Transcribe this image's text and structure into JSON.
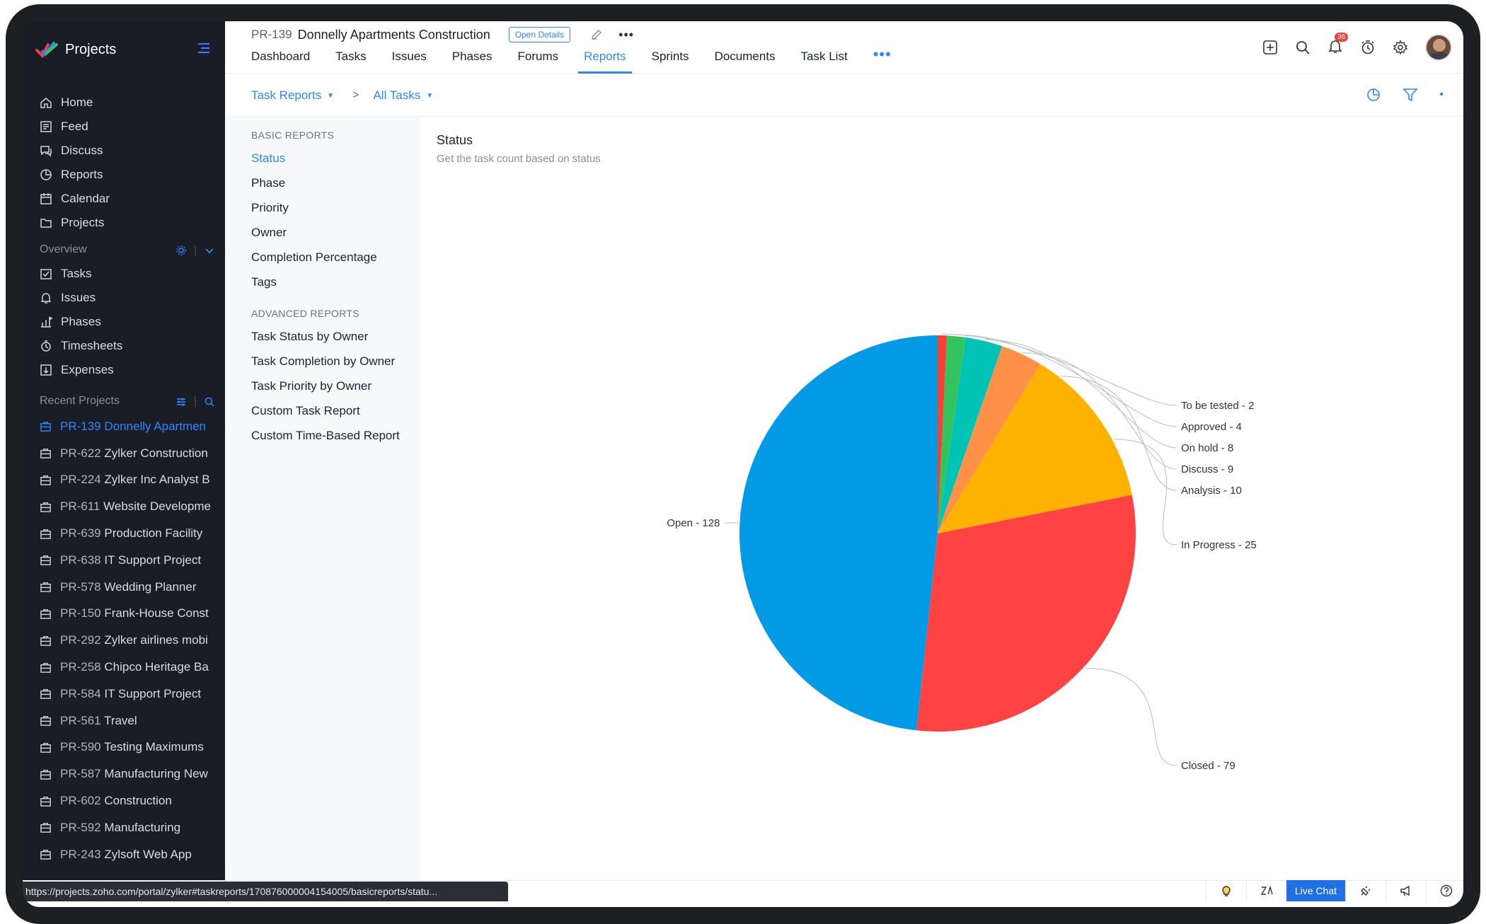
{
  "app": {
    "title": "Projects"
  },
  "sidebar": {
    "main_items": [
      {
        "label": "Home",
        "icon": "home-icon"
      },
      {
        "label": "Feed",
        "icon": "feed-icon"
      },
      {
        "label": "Discuss",
        "icon": "discuss-icon"
      },
      {
        "label": "Reports",
        "icon": "reports-icon"
      },
      {
        "label": "Calendar",
        "icon": "calendar-icon"
      },
      {
        "label": "Projects",
        "icon": "projects-icon"
      }
    ],
    "overview": {
      "title": "Overview",
      "items": [
        {
          "label": "Tasks",
          "icon": "tasks-icon"
        },
        {
          "label": "Issues",
          "icon": "issues-icon"
        },
        {
          "label": "Phases",
          "icon": "phases-icon"
        },
        {
          "label": "Timesheets",
          "icon": "timesheets-icon"
        },
        {
          "label": "Expenses",
          "icon": "expenses-icon"
        }
      ]
    },
    "recent": {
      "title": "Recent Projects",
      "items": [
        {
          "code": "PR-139",
          "name": "Donnelly Apartmen",
          "active": true
        },
        {
          "code": "PR-622",
          "name": "Zylker Construction"
        },
        {
          "code": "PR-224",
          "name": "Zylker Inc Analyst B"
        },
        {
          "code": "PR-611",
          "name": "Website Developme"
        },
        {
          "code": "PR-639",
          "name": "Production Facility"
        },
        {
          "code": "PR-638",
          "name": "IT Support Project"
        },
        {
          "code": "PR-578",
          "name": "Wedding Planner"
        },
        {
          "code": "PR-150",
          "name": "Frank-House Const"
        },
        {
          "code": "PR-292",
          "name": "Zylker airlines mobi"
        },
        {
          "code": "PR-258",
          "name": "Chipco Heritage Ba"
        },
        {
          "code": "PR-584",
          "name": "IT Support Project"
        },
        {
          "code": "PR-561",
          "name": "Travel"
        },
        {
          "code": "PR-590",
          "name": "Testing Maximums"
        },
        {
          "code": "PR-587",
          "name": "Manufacturing New"
        },
        {
          "code": "PR-602",
          "name": "Construction"
        },
        {
          "code": "PR-592",
          "name": "Manufacturing"
        },
        {
          "code": "PR-243",
          "name": "Zylsoft Web App"
        }
      ]
    }
  },
  "header": {
    "project_code": "PR-139",
    "project_name": "Donnelly Apartments Construction",
    "open_details": "Open Details",
    "tabs": [
      "Dashboard",
      "Tasks",
      "Issues",
      "Phases",
      "Forums",
      "Reports",
      "Sprints",
      "Documents",
      "Task List"
    ],
    "active_tab": "Reports",
    "more": "•••",
    "notification_count": "36"
  },
  "subheader": {
    "crumb1": "Task Reports",
    "crumb_sep": ">",
    "crumb2": "All Tasks"
  },
  "reports_menu": {
    "basic_title": "BASIC REPORTS",
    "basic": [
      "Status",
      "Phase",
      "Priority",
      "Owner",
      "Completion Percentage",
      "Tags"
    ],
    "advanced_title": "ADVANCED REPORTS",
    "advanced": [
      "Task Status by Owner",
      "Task Completion by Owner",
      "Task Priority by Owner",
      "Custom Task Report",
      "Custom Time-Based Report"
    ]
  },
  "report": {
    "title": "Status",
    "subtitle": "Get the task count based on status"
  },
  "chart_data": {
    "type": "pie",
    "slices": [
      {
        "label": "Open",
        "value": 128,
        "color": "#039be5"
      },
      {
        "label": "To be tested",
        "value": 2,
        "color": "#f44336"
      },
      {
        "label": "Approved",
        "value": 4,
        "color": "#33c45f"
      },
      {
        "label": "On hold",
        "value": 8,
        "color": "#00c3b5"
      },
      {
        "label": "Discuss",
        "value": 9,
        "color": "#ff9048"
      },
      {
        "label": "Analysis",
        "value": 10,
        "color": "#ffb300"
      },
      {
        "label": "In Progress",
        "value": 25,
        "color": "#ffb300"
      },
      {
        "label": "Closed",
        "value": 79,
        "color": "#ff4242"
      }
    ]
  },
  "status_bar": {
    "url": "https://projects.zoho.com/portal/zylker#taskreports/170876000004154005/basicreports/statu...",
    "live_chat": "Live Chat"
  }
}
